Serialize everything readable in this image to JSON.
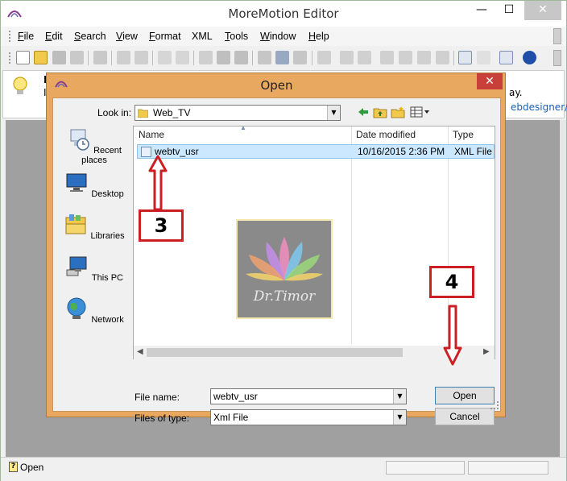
{
  "app": {
    "title": "MoreMotion Editor",
    "window_buttons": {
      "minimize": "—",
      "maximize": "☐",
      "close": "✕"
    }
  },
  "menu": [
    {
      "label": "File",
      "accel": "F",
      "rest": "ile"
    },
    {
      "label": "Edit",
      "accel": "E",
      "rest": "dit"
    },
    {
      "label": "Search",
      "accel": "S",
      "rest": "earch"
    },
    {
      "label": "View",
      "accel": "V",
      "rest": "iew"
    },
    {
      "label": "Format",
      "accel": "F",
      "rest": "ormat"
    },
    {
      "label": "XML",
      "accel": "",
      "rest": "XML"
    },
    {
      "label": "Tools",
      "accel": "T",
      "rest": "ools"
    },
    {
      "label": "Window",
      "accel": "W",
      "rest": "indow"
    },
    {
      "label": "Help",
      "accel": "H",
      "rest": "elp"
    }
  ],
  "infobar": {
    "fragment_bold": "N",
    "fragment_left": "I",
    "fragment_right": "ay.",
    "link": "ebdesigner/"
  },
  "dialog": {
    "title": "Open",
    "close": "✕",
    "look_in_label": "Look in:",
    "look_in_value": "Web_TV",
    "places": [
      "Recent places",
      "Desktop",
      "Libraries",
      "This PC",
      "Network"
    ],
    "columns": [
      "Name",
      "Date modified",
      "Type"
    ],
    "files": [
      {
        "name": "webtv_usr",
        "date": "10/16/2015 2:36 PM",
        "type": "XML File"
      }
    ],
    "file_name_label": "File name:",
    "file_name_value": "webtv_usr",
    "file_type_label": "Files of type:",
    "file_type_value": "Xml File",
    "open_button": "Open",
    "cancel_button": "Cancel"
  },
  "watermark": {
    "text": "Dr.Timor"
  },
  "annotations": {
    "step3": "3",
    "step4": "4"
  },
  "status": {
    "text": "Open"
  },
  "colors": {
    "dialog_frame": "#e8a860",
    "selection": "#cce8ff",
    "callout_border": "#cc1f24"
  }
}
